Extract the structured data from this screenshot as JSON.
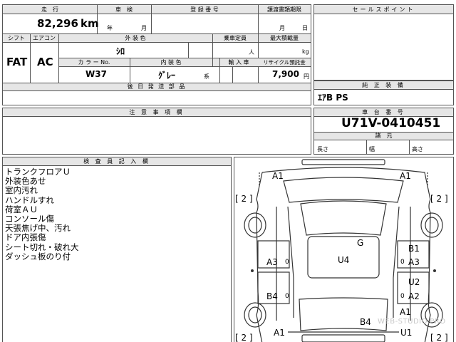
{
  "top_row": {
    "mileage_label": "走　行",
    "mileage_value": "82,296",
    "mileage_unit": "km",
    "inspection_label": "車　検",
    "inspection_year": "年",
    "inspection_month": "月",
    "registration_label": "登 録 番 号",
    "transfer_deadline_label": "譲渡書類期限",
    "transfer_month": "月",
    "transfer_day": "日"
  },
  "sales_point": {
    "label": "セールスポイント"
  },
  "spec_row": {
    "shift_label": "シフト",
    "shift_value": "FAT",
    "aircon_label": "エアコン",
    "aircon_value": "AC",
    "exterior_label": "外 装 色",
    "exterior_value": "ｼﾛ",
    "capacity_label": "乗車定員",
    "capacity_unit": "人",
    "max_load_label": "最大積載量",
    "max_load_unit": "kg",
    "color_label": "カ ラ ー No.",
    "color_value": "W37",
    "interior_label": "内 装 色",
    "interior_value": "ｸﾞﾚｰ",
    "interior_unit": "系",
    "import_label": "輸 入 車",
    "recycle_label": "リサイクル預託金",
    "recycle_value": "7,900",
    "recycle_unit": "円"
  },
  "later_parts": {
    "label": "後 日 発 送 部 品"
  },
  "equipment": {
    "label": "純 正 装 備",
    "value": "ｴｱB PS"
  },
  "cautions": {
    "label": "注 意 事 項 欄"
  },
  "chassis": {
    "label": "車 台 番 号",
    "value": "U71V-0410451",
    "dimensions_label": "諸　元",
    "length_label": "長さ",
    "width_label": "幅",
    "height_label": "高さ"
  },
  "inspector": {
    "label": "検 査 員 記 入 欄",
    "notes": [
      "トランクフロアＵ",
      "外装色あせ",
      "室内汚れ",
      "ハンドルすれ",
      "荷室ＡＵ",
      "コンソール傷",
      "天張焦げ中、汚れ",
      "ドア内張傷",
      "シート切れ・破れ大",
      "ダッシュ板のり付"
    ]
  },
  "damage_map": {
    "codes": {
      "front_left": "A1",
      "front_right": "A1",
      "left_mid": "A3",
      "left_rear": "B4",
      "bottom_left": "A1",
      "roof": "G",
      "center": "U4",
      "right_b1": "B1",
      "right_a3": "A3",
      "right_u2": "U2",
      "right_a2": "A2",
      "right_a1": "A1",
      "rear_b4": "B4",
      "rear_u1": "U1"
    },
    "brackets": [
      "[ 2 ]",
      "[ 2 ]",
      "[ 2 ]",
      "[ 2 ]"
    ],
    "zero_marks": [
      "0",
      "0",
      "0",
      "0"
    ],
    "watermark": "WEB-STUDIO.PRO"
  },
  "colors": {
    "border": "#555555",
    "header_bg": "#e6e6e6",
    "watermark": "#c8c8c8"
  }
}
